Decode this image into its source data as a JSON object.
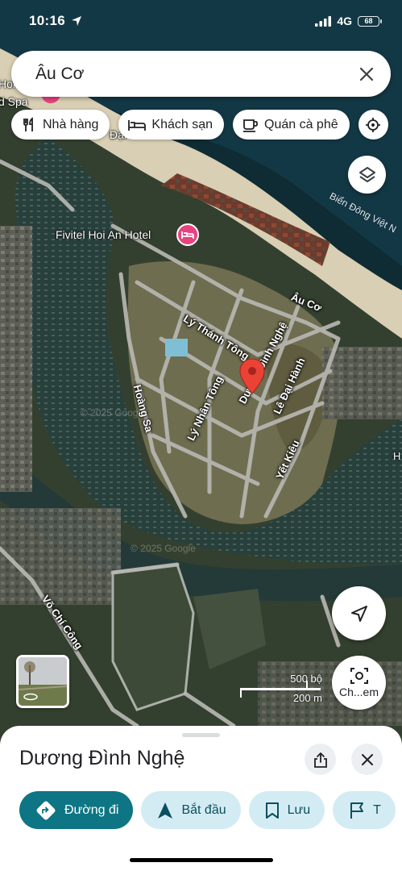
{
  "status_bar": {
    "time": "10:16",
    "network": "4G",
    "battery": "68"
  },
  "search": {
    "query": "Âu Cơ"
  },
  "chips": [
    {
      "label": "Nhà hàng",
      "icon": "fork-knife-icon"
    },
    {
      "label": "Khách sạn",
      "icon": "bed-icon"
    },
    {
      "label": "Quán cà phê",
      "icon": "coffee-cup-icon"
    },
    {
      "label": "",
      "icon": "more-places-icon"
    }
  ],
  "map": {
    "poi_hotel": "Fivitel Hoi An Hotel",
    "poi_topleft_1": "Hoi",
    "poi_topleft_2": "d Spa",
    "poi_topleft_3": "Đại",
    "sea_label": "Biển Đông Việt N",
    "road_au_co": "Âu Cơ",
    "road_ly_thanh_tong": "Lý Thánh Tông",
    "road_duong_dinh_nghe": "Dương Đình Nghệ",
    "road_le_dai_hanh": "Lê Đại Hành",
    "road_ly_nhan_tong": "Lý Nhân Tông",
    "road_hoang_sa": "Hoàng Sa",
    "road_yet_kieu": "Yết Kiêu",
    "road_vo_chi_cong": "Võ Chí Công",
    "edge_h": "H",
    "watermark_1": "© 2025 Google",
    "watermark_2": "© 2025 Google",
    "pin_color": "#ea4335"
  },
  "scale": {
    "top": "500 bộ",
    "bottom": "200 m"
  },
  "street_view": {
    "label": "Ch...em"
  },
  "place": {
    "title": "Dương Đình Nghệ",
    "actions": [
      {
        "label": "Đường đi",
        "icon": "directions-icon",
        "style": "primary"
      },
      {
        "label": "Bắt đầu",
        "icon": "navigation-arrow-icon",
        "style": "secondary"
      },
      {
        "label": "Lưu",
        "icon": "bookmark-icon",
        "style": "secondary"
      },
      {
        "label": "T",
        "icon": "flag-icon",
        "style": "secondary"
      }
    ]
  },
  "colors": {
    "accent": "#0d7583",
    "accent_light": "#d3ecf4"
  }
}
